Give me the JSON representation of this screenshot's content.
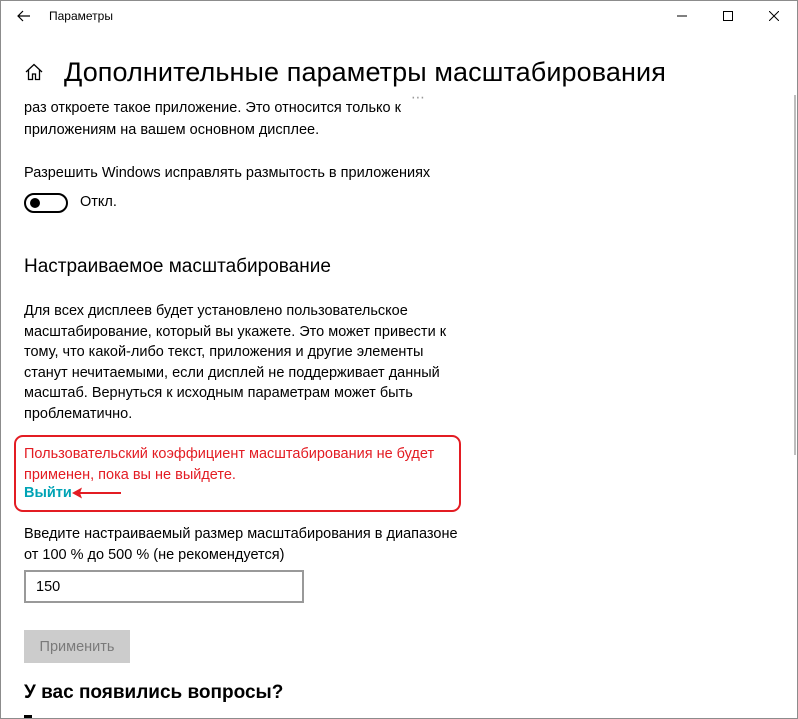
{
  "window": {
    "title": "Параметры",
    "controls": [
      "minimize",
      "maximize",
      "close"
    ]
  },
  "header": {
    "title": "Дополнительные параметры масштабирования"
  },
  "intro": {
    "partial_line_1": "раз откроете такое приложение. Это относится только к",
    "partial_line_2": "приложениям на вашем основном дисплее."
  },
  "blur_fix": {
    "label": "Разрешить Windows исправлять размытость в приложениях",
    "state_label": "Откл.",
    "state": "off"
  },
  "custom_scaling": {
    "title": "Настраиваемое масштабирование",
    "description_lines": [
      "Для всех дисплеев будет установлено пользовательское",
      "масштабирование, который вы укажете. Это может привести к",
      "тому, что какой-либо текст, приложения и другие элементы",
      "станут нечитаемыми, если дисплей не поддерживает данный",
      "масштаб. Вернуться к исходным параметрам может быть",
      "проблематично."
    ],
    "warning_lines": [
      "Пользовательский коэффициент масштабирования не будет",
      "применен, пока вы не выйдете."
    ],
    "signout_link": "Выйти",
    "input_label_lines": [
      "Введите настраиваемый размер масштабирования в диапазоне",
      "от 100 % до 500 % (не рекомендуется)"
    ],
    "input_value": "150",
    "apply_button": "Применить"
  },
  "questions": {
    "title": "У вас появились вопросы?"
  },
  "colors": {
    "warning": "#e31c23",
    "link": "#00a3b5",
    "disabled_button_bg": "#cccccc",
    "disabled_button_text": "#7a7a7a"
  }
}
